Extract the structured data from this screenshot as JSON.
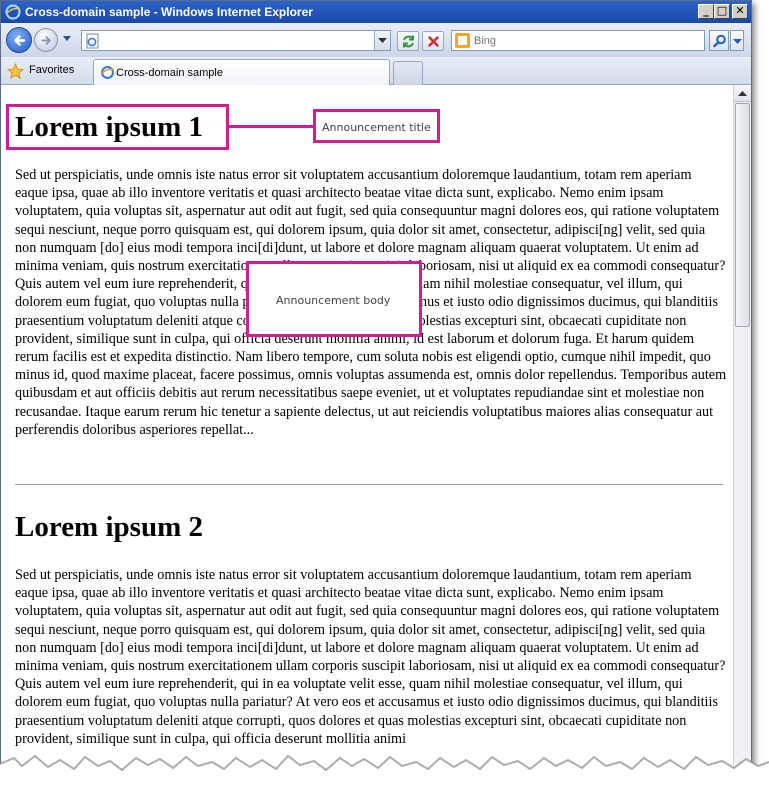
{
  "window": {
    "title": "Cross-domain sample - Windows Internet Explorer",
    "minimize": "_",
    "maximize": "□",
    "close": "✕"
  },
  "toolbar": {
    "address_value": "",
    "search_placeholder": "Bing"
  },
  "favorites_bar": {
    "favorites_label": "Favorites",
    "tab_label": "Cross-domain sample"
  },
  "article": {
    "heading_1": "Lorem ipsum 1",
    "body_1": "Sed ut perspiciatis, unde omnis iste natus error sit voluptatem accusantium doloremque laudantium, totam rem aperiam eaque ipsa, quae ab illo inventore veritatis et quasi architecto beatae vitae dicta sunt, explicabo. Nemo enim ipsam voluptatem, quia voluptas sit, aspernatur aut odit aut fugit, sed quia consequuntur magni dolores eos, qui ratione voluptatem sequi nesciunt, neque porro quisquam est, qui dolorem ipsum, quia dolor sit amet, consectetur, adipisci[ng] velit, sed quia non numquam [do] eius modi tempora inci[di]dunt, ut labore et dolore magnam aliquam quaerat voluptatem. Ut enim ad minima veniam, quis nostrum exercitationem ullam corporis suscipit laboriosam, nisi ut aliquid ex ea commodi consequatur? Quis autem vel eum iure reprehenderit, qui in ea voluptate velit esse, quam nihil molestiae consequatur, vel illum, qui dolorem eum fugiat, quo voluptas nulla pariatur? At vero eos et accusamus et iusto odio dignissimos ducimus, qui blanditiis praesentium voluptatum deleniti atque corrupti, quos dolores et quas molestias excepturi sint, obcaecati cupiditate non provident, similique sunt in culpa, qui officia deserunt mollitia animi, id est laborum et dolorum fuga. Et harum quidem rerum facilis est et expedita distinctio. Nam libero tempore, cum soluta nobis est eligendi optio, cumque nihil impedit, quo minus id, quod maxime placeat, facere possimus, omnis voluptas assumenda est, omnis dolor repellendus. Temporibus autem quibusdam et aut officiis debitis aut rerum necessitatibus saepe eveniet, ut et voluptates repudiandae sint et molestiae non recusandae. Itaque earum rerum hic tenetur a sapiente delectus, ut aut reiciendis voluptatibus maiores alias consequatur aut perferendis doloribus asperiores repellat...",
    "heading_2": "Lorem ipsum 2",
    "body_2": "Sed ut perspiciatis, unde omnis iste natus error sit voluptatem accusantium doloremque laudantium, totam rem aperiam eaque ipsa, quae ab illo inventore veritatis et quasi architecto beatae vitae dicta sunt, explicabo. Nemo enim ipsam voluptatem, quia voluptas sit, aspernatur aut odit aut fugit, sed quia consequuntur magni dolores eos, qui ratione voluptatem sequi nesciunt, neque porro quisquam est, qui dolorem ipsum, quia dolor sit amet, consectetur, adipisci[ng] velit, sed quia non numquam [do] eius modi tempora inci[di]dunt, ut labore et dolore magnam aliquam quaerat voluptatem. Ut enim ad minima veniam, quis nostrum exercitationem ullam corporis suscipit laboriosam, nisi ut aliquid ex ea commodi consequatur? Quis autem vel eum iure reprehenderit, qui in ea voluptate velit esse, quam nihil molestiae consequatur, vel illum, qui dolorem eum fugiat, quo voluptas nulla pariatur? At vero eos et accusamus et iusto odio dignissimos ducimus, qui blanditiis praesentium voluptatum deleniti atque corrupti, quos dolores et quas molestias excepturi sint, obcaecati cupiditate non provident, similique sunt in culpa, qui officia deserunt mollitia animi"
  },
  "annotations": {
    "title_label": "Announcement title",
    "body_label": "Announcement body",
    "color": "#d01f8f"
  },
  "icons": {
    "app": "ie-icon",
    "back": "back-arrow-icon",
    "forward": "forward-arrow-icon",
    "refresh": "refresh-icon",
    "stop": "stop-icon",
    "search": "magnifier-icon",
    "favorites": "star-icon"
  }
}
